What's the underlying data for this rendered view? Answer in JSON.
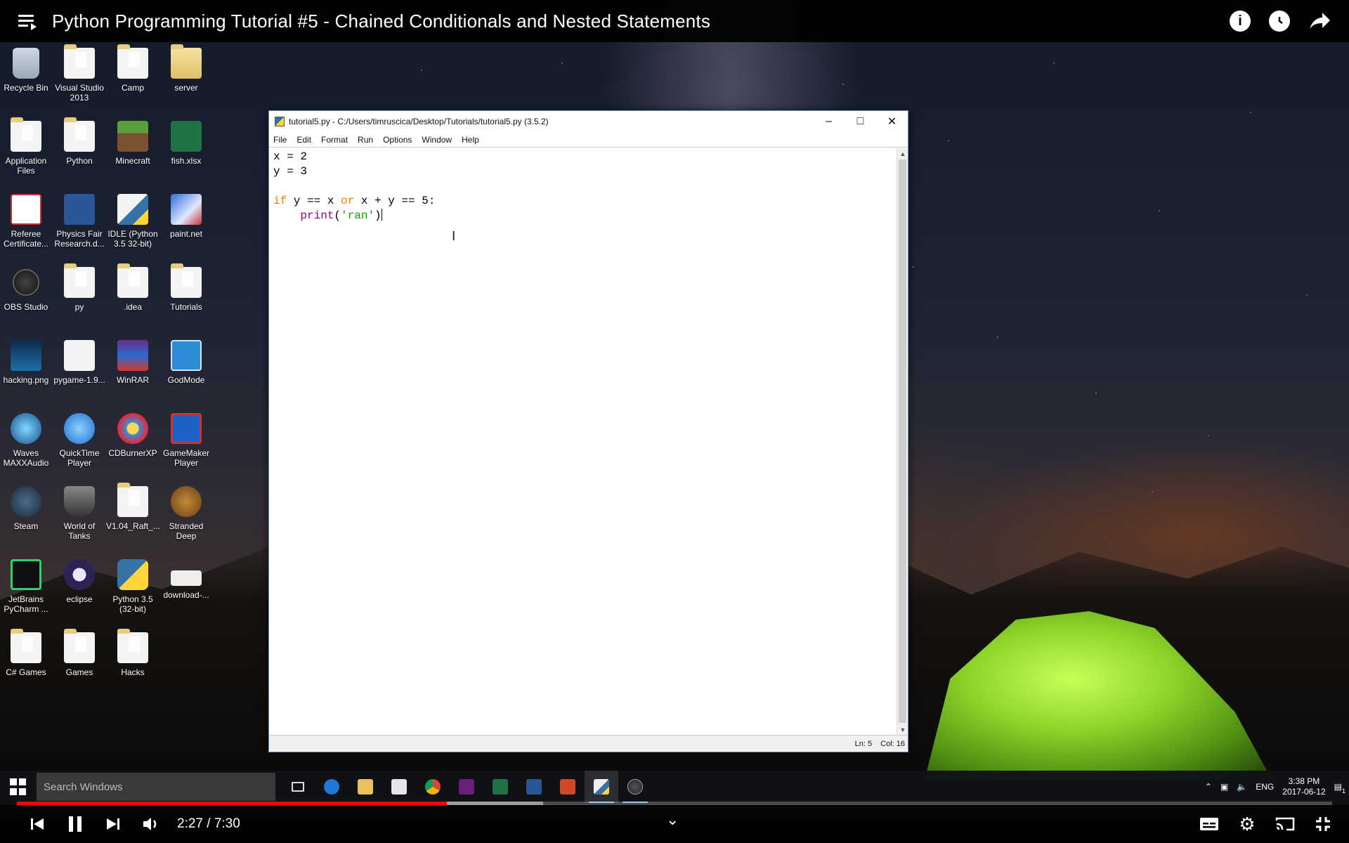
{
  "video": {
    "title": "Python Programming Tutorial #5 - Chained Conditionals and Nested Statements",
    "time_display": "2:27 / 7:30",
    "progress_played_fraction": 0.327,
    "progress_loaded_fraction": 0.4
  },
  "desktop_icons": [
    {
      "label": "Recycle Bin",
      "icon": "recycle"
    },
    {
      "label": "Visual Studio 2013",
      "icon": "folder doc"
    },
    {
      "label": "Camp",
      "icon": "folder doc"
    },
    {
      "label": "server",
      "icon": "folder"
    },
    {
      "label": "Application Files",
      "icon": "folder doc"
    },
    {
      "label": "Python",
      "icon": "folder doc"
    },
    {
      "label": "Minecraft",
      "icon": "minecraft"
    },
    {
      "label": "fish.xlsx",
      "icon": "excel"
    },
    {
      "label": "Referee Certificate...",
      "icon": "cert"
    },
    {
      "label": "Physics Fair Research.d...",
      "icon": "word"
    },
    {
      "label": "IDLE (Python 3.5 32-bit)",
      "icon": "idle"
    },
    {
      "label": "paint.net",
      "icon": "paint"
    },
    {
      "label": "OBS Studio",
      "icon": "obs"
    },
    {
      "label": "py",
      "icon": "folder doc"
    },
    {
      "label": ".idea",
      "icon": "folder doc"
    },
    {
      "label": "Tutorials",
      "icon": "folder doc"
    },
    {
      "label": "hacking.png",
      "icon": "hacking"
    },
    {
      "label": "pygame-1.9...",
      "icon": "doc"
    },
    {
      "label": "WinRAR",
      "icon": "winrar"
    },
    {
      "label": "GodMode",
      "icon": "godmode"
    },
    {
      "label": "Waves MAXXAudio",
      "icon": "waves"
    },
    {
      "label": "QuickTime Player",
      "icon": "quicktime"
    },
    {
      "label": "CDBurnerXP",
      "icon": "cdburner"
    },
    {
      "label": "GameMaker Player",
      "icon": "gamemaker"
    },
    {
      "label": "Steam",
      "icon": "steam"
    },
    {
      "label": "World of Tanks",
      "icon": "wot"
    },
    {
      "label": "V1.04_Raft_...",
      "icon": "folder doc"
    },
    {
      "label": "Stranded Deep",
      "icon": "stranded"
    },
    {
      "label": "JetBrains PyCharm ...",
      "icon": "pycharm"
    },
    {
      "label": "eclipse",
      "icon": "eclipse"
    },
    {
      "label": "Python 3.5 (32-bit)",
      "icon": "python"
    },
    {
      "label": "download-...",
      "icon": "download"
    },
    {
      "label": "C# Games",
      "icon": "folder doc"
    },
    {
      "label": "Games",
      "icon": "folder doc"
    },
    {
      "label": "Hacks",
      "icon": "folder doc"
    }
  ],
  "idle": {
    "title": "tutorial5.py - C:/Users/timruscica/Desktop/Tutorials/tutorial5.py (3.5.2)",
    "menus": [
      "File",
      "Edit",
      "Format",
      "Run",
      "Options",
      "Window",
      "Help"
    ],
    "code": {
      "l1": "x = 2",
      "l2": "y = 3",
      "l4_if": "if",
      "l4_a": " y == x ",
      "l4_or": "or",
      "l4_b": " x + y == 5:",
      "l5_indent": "    ",
      "l5_print": "print",
      "l5_open": "(",
      "l5_str": "'ran'",
      "l5_close": ")"
    },
    "status_ln": "Ln: 5",
    "status_col": "Col: 16"
  },
  "taskbar": {
    "search_placeholder": "Search Windows",
    "language": "ENG",
    "time": "3:38 PM",
    "date": "2017-06-12",
    "notification_count": "1"
  },
  "colors": {
    "keyword": "#ff7700",
    "builtin": "#900090",
    "string": "#00aa00",
    "progress": "#ff0000"
  }
}
